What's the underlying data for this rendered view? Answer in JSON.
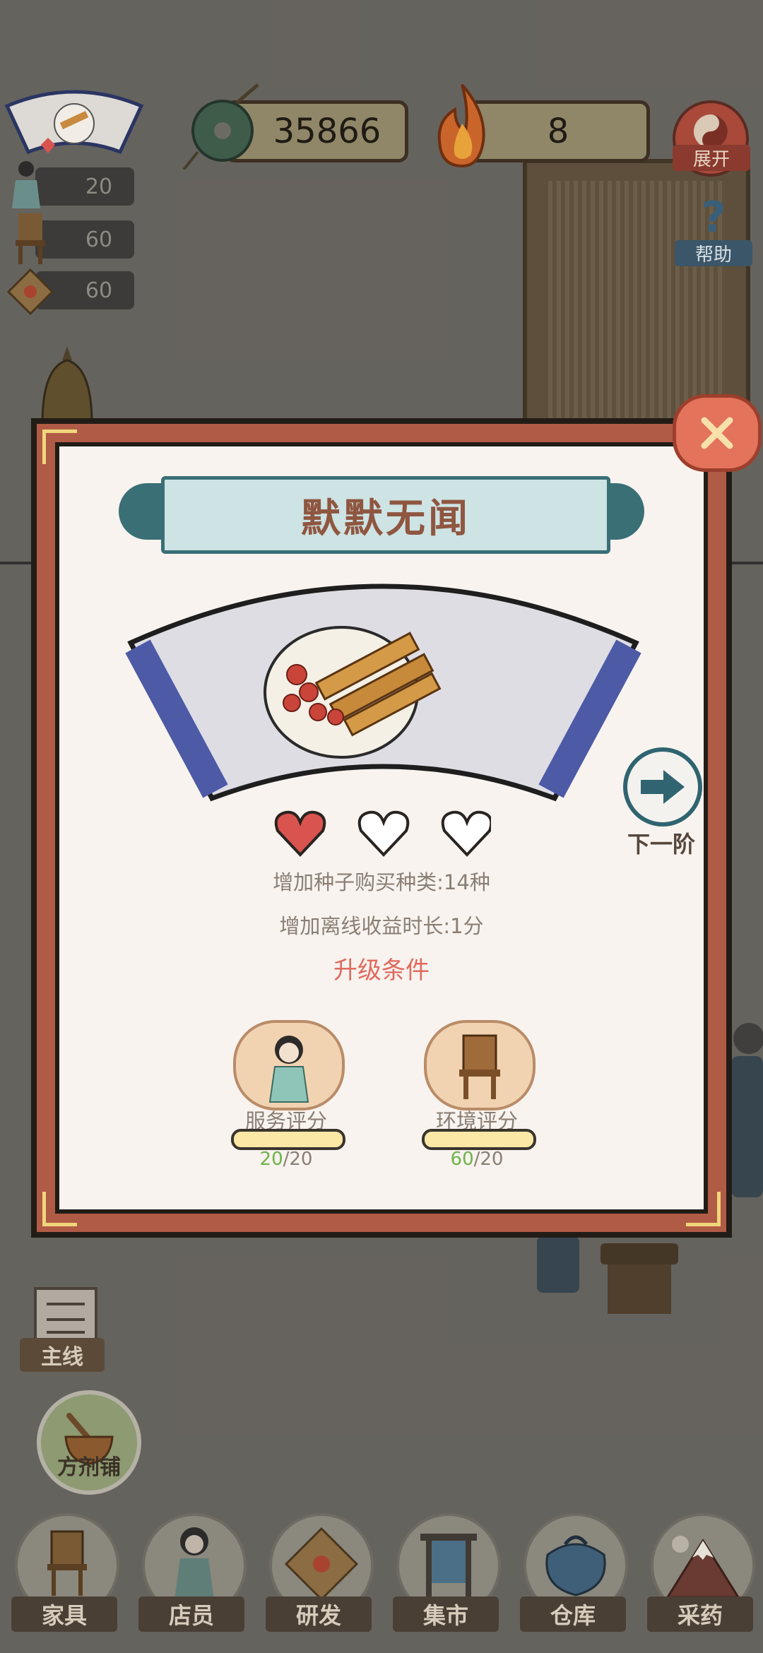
{
  "hud": {
    "coins": "35866",
    "fire": "8",
    "expand_label": "展开",
    "help_label": "帮助"
  },
  "left_stats": [
    {
      "icon": "staff-icon",
      "value": "20"
    },
    {
      "icon": "chair-icon",
      "value": "60"
    },
    {
      "icon": "package-icon",
      "value": "60"
    }
  ],
  "dialog": {
    "title": "默默无闻",
    "hearts_filled": 1,
    "hearts_total": 3,
    "info_line_1": "增加种子购买种类:14种",
    "info_line_2": "增加离线收益时长:1分",
    "conditions_title": "升级条件",
    "next_label": "下一阶",
    "requirements": [
      {
        "label": "服务评分",
        "current": "20",
        "total": "/20",
        "progress": 1.0
      },
      {
        "label": "环境评分",
        "current": "60",
        "total": "/20",
        "progress": 1.0
      }
    ]
  },
  "side_buttons": {
    "quest_label": "主线",
    "pharmacy_label": "方剂铺"
  },
  "bottom_nav": [
    {
      "label": "家具",
      "icon": "chair-icon"
    },
    {
      "label": "店员",
      "icon": "staff-icon"
    },
    {
      "label": "研发",
      "icon": "research-icon"
    },
    {
      "label": "集市",
      "icon": "market-icon"
    },
    {
      "label": "仓库",
      "icon": "warehouse-icon"
    },
    {
      "label": "采药",
      "icon": "mountain-icon"
    }
  ],
  "colors": {
    "dialog_frame": "#b05b45",
    "paper": "#f8f3ee",
    "title_text": "#8f5640",
    "banner": "#cde3e4",
    "condition_text": "#e06a5f",
    "heart_red": "#d9534f"
  }
}
